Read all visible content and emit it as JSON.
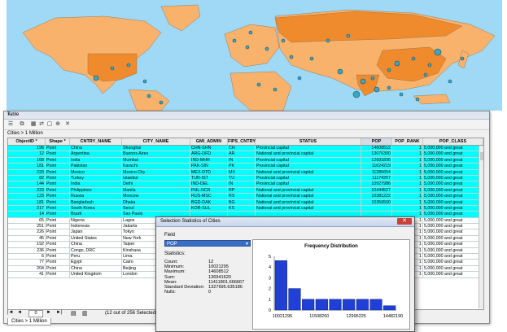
{
  "colors": {
    "ocean": "#9fd9f6",
    "land": "#f8b26b",
    "land_selected": "#ef8b2c",
    "city_point": "#3aa6c2",
    "selected_row": "#00ffff",
    "dropdown": "#3a6fc5",
    "bar": "#1f3fd6"
  },
  "table_window": {
    "title": "Table",
    "close_icon": "close-icon",
    "layer_label": "Cities > 1 Million",
    "toolbar_icons": [
      "table-options-icon",
      "related-tables-icon",
      "select-by-attributes-icon",
      "switch-selection-icon",
      "clear-selection-icon",
      "zoom-to-selected-icon",
      "delete-selected-icon"
    ],
    "columns": [
      "ObjectID *",
      "Shape *",
      "CNTRY_NAME",
      "CITY_NAME",
      "GMI_ADMIN",
      "FIPS_CNTRY",
      "STATUS",
      "POP",
      "POP_RANK",
      "POP_CLASS"
    ],
    "rows": [
      {
        "sel": true,
        "cells": [
          "196",
          "Point",
          "China",
          "Shanghai",
          "CHN-SHN",
          "CH",
          "Provincial capital",
          "14608512",
          "1",
          "5,000,000 and great"
        ]
      },
      {
        "sel": true,
        "cells": [
          "12",
          "Point",
          "Argentina",
          "Buenos Aires",
          "ARG-DFD",
          "AR",
          "National and provincial capital",
          "13076300",
          "1",
          "5,000,000 and great"
        ]
      },
      {
        "sel": true,
        "cells": [
          "168",
          "Point",
          "India",
          "Mumbai",
          "IND-MHR",
          "IN",
          "Provincial capital",
          "12691836",
          "1",
          "5,000,000 and great"
        ]
      },
      {
        "sel": true,
        "cells": [
          "181",
          "Point",
          "Pakistan",
          "Karachi",
          "PAK-SIN",
          "PK",
          "Provincial capital",
          "11624219",
          "1",
          "5,000,000 and great"
        ]
      },
      {
        "sel": true,
        "cells": [
          "220",
          "Point",
          "Mexico",
          "Mexico City",
          "MEX-DTD",
          "MX",
          "National and provincial capital",
          "11285654",
          "1",
          "5,000,000 and great"
        ]
      },
      {
        "sel": true,
        "cells": [
          "82",
          "Point",
          "Turkey",
          "Istanbul",
          "TUR-IST",
          "TU",
          "Provincial capital",
          "11174257",
          "1",
          "5,000,000 and great"
        ]
      },
      {
        "sel": true,
        "cells": [
          "144",
          "Point",
          "India",
          "Delhi",
          "IND-DEL",
          "IN",
          "Provincial capital",
          "10927986",
          "1",
          "5,000,000 and great"
        ]
      },
      {
        "sel": true,
        "cells": [
          "223",
          "Point",
          "Philippines",
          "Manila",
          "PHL-NCR",
          "RP",
          "National and provincial capital",
          "10444527",
          "1",
          "5,000,000 and great"
        ]
      },
      {
        "sel": true,
        "cells": [
          "123",
          "Point",
          "Russia",
          "Moscow",
          "RUS-MSC",
          "RS",
          "National and provincial capital",
          "10381222",
          "1",
          "5,000,000 and great"
        ]
      },
      {
        "sel": true,
        "cells": [
          "181",
          "Point",
          "Bangladesh",
          "Dhaka",
          "BGD-DAK",
          "BG",
          "National and provincial capital",
          "10356500",
          "1",
          "5,000,000 and great"
        ]
      },
      {
        "sel": true,
        "cells": [
          "217",
          "Point",
          "South Korea",
          "Seoul",
          "KOR-SUL",
          "KS",
          "National and provincial capital",
          "",
          "1",
          "5,000,000 and great"
        ]
      },
      {
        "sel": true,
        "cells": [
          "14",
          "Point",
          "Brazil",
          "Sao Paulo",
          "",
          "",
          "",
          "",
          "1",
          "5,000,000 and great"
        ]
      },
      {
        "sel": false,
        "cells": [
          "65",
          "Point",
          "Nigeria",
          "Lagos",
          "",
          "",
          "",
          "",
          "1",
          "5,000,000 and great"
        ]
      },
      {
        "sel": false,
        "cells": [
          "251",
          "Point",
          "Indonesia",
          "Jakarta",
          "",
          "",
          "",
          "",
          "1",
          "5,000,000 and great"
        ]
      },
      {
        "sel": false,
        "cells": [
          "226",
          "Point",
          "Japan",
          "Tokyo",
          "",
          "",
          "",
          "",
          "1",
          "5,000,000 and great"
        ]
      },
      {
        "sel": false,
        "cells": [
          "45",
          "Point",
          "United States",
          "New York",
          "",
          "",
          "",
          "",
          "1",
          "5,000,000 and great"
        ]
      },
      {
        "sel": false,
        "cells": [
          "192",
          "Point",
          "China",
          "Taipei",
          "",
          "",
          "",
          "",
          "1",
          "5,000,000 and great"
        ]
      },
      {
        "sel": false,
        "cells": [
          "236",
          "Point",
          "Congo, DRC",
          "Kinshasa",
          "",
          "",
          "",
          "",
          "1",
          "5,000,000 and great"
        ]
      },
      {
        "sel": false,
        "cells": [
          "6",
          "Point",
          "Peru",
          "Lima",
          "",
          "",
          "",
          "",
          "1",
          "5,000,000 and great"
        ]
      },
      {
        "sel": false,
        "cells": [
          "77",
          "Point",
          "Egypt",
          "Cairo",
          "",
          "",
          "",
          "",
          "1",
          "5,000,000 and great"
        ]
      },
      {
        "sel": false,
        "cells": [
          "204",
          "Point",
          "China",
          "Beijing",
          "",
          "",
          "",
          "",
          "1",
          "5,000,000 and great"
        ]
      },
      {
        "sel": false,
        "cells": [
          "41",
          "Point",
          "United Kingdom",
          "London",
          "",
          "",
          "",
          "",
          "1",
          "5,000,000 and great"
        ]
      }
    ],
    "nav": {
      "first": "|◄",
      "prev": "◄",
      "position": "0",
      "next": "►",
      "last": "►|"
    },
    "selection_count": "(12 out of 256 Selected)",
    "tab_label": "Cities > 1 Million"
  },
  "dialog": {
    "title": "Selection Statistics of Cities",
    "field_label": "Field",
    "field_value": "POP",
    "statistics_label": "Statistics:",
    "stats": [
      {
        "k": "Count:",
        "v": "12"
      },
      {
        "k": "Minimum:",
        "v": "10021295"
      },
      {
        "k": "Maximum:",
        "v": "14608512"
      },
      {
        "k": "Sum:",
        "v": "136941620"
      },
      {
        "k": "Mean:",
        "v": "11411801.666667"
      },
      {
        "k": "Standard Deviation:",
        "v": "1327695.635186"
      },
      {
        "k": "Nulls:",
        "v": "0"
      }
    ]
  },
  "chart_data": {
    "type": "bar",
    "title": "Frequency Distribution",
    "xlabel": "",
    "ylabel": "",
    "x_tick_labels": [
      "10021295",
      "11508260",
      "12995225",
      "14482190"
    ],
    "y_tick_labels": [
      "0",
      "1",
      "2",
      "3",
      "4",
      "5"
    ],
    "ylim": [
      0,
      5
    ],
    "values": [
      4.6,
      2.0,
      1.0,
      1.0,
      1.0,
      1.0,
      1.0,
      1.0,
      0.4
    ]
  }
}
